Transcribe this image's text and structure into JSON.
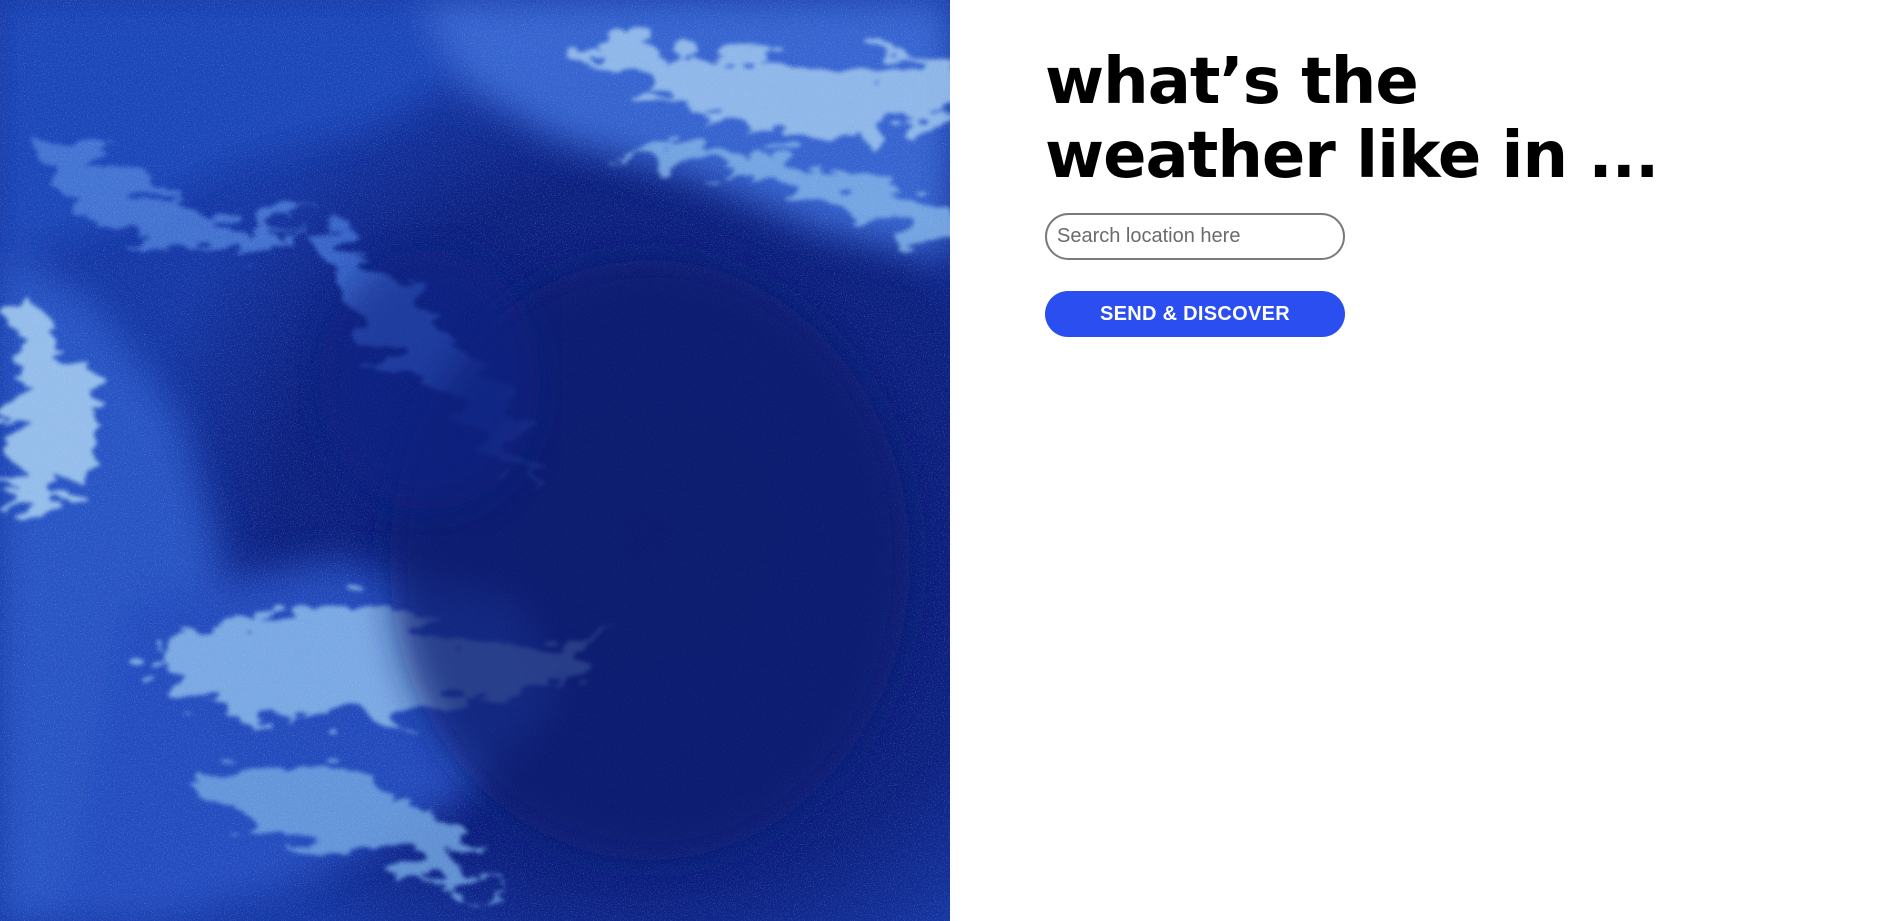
{
  "headline": {
    "line1": "what’s the",
    "line2": "weather like in ..."
  },
  "search": {
    "placeholder": "Search location here",
    "value": ""
  },
  "actions": {
    "discover_label": "SEND & DISCOVER"
  },
  "colors": {
    "accent": "#2a4ef0",
    "ocean_deep": "#0a1a6e",
    "ocean_mid": "#1e46b8",
    "ocean_light": "#9cc8f0"
  },
  "hero": {
    "image_subject": "satellite-ocean-image"
  }
}
